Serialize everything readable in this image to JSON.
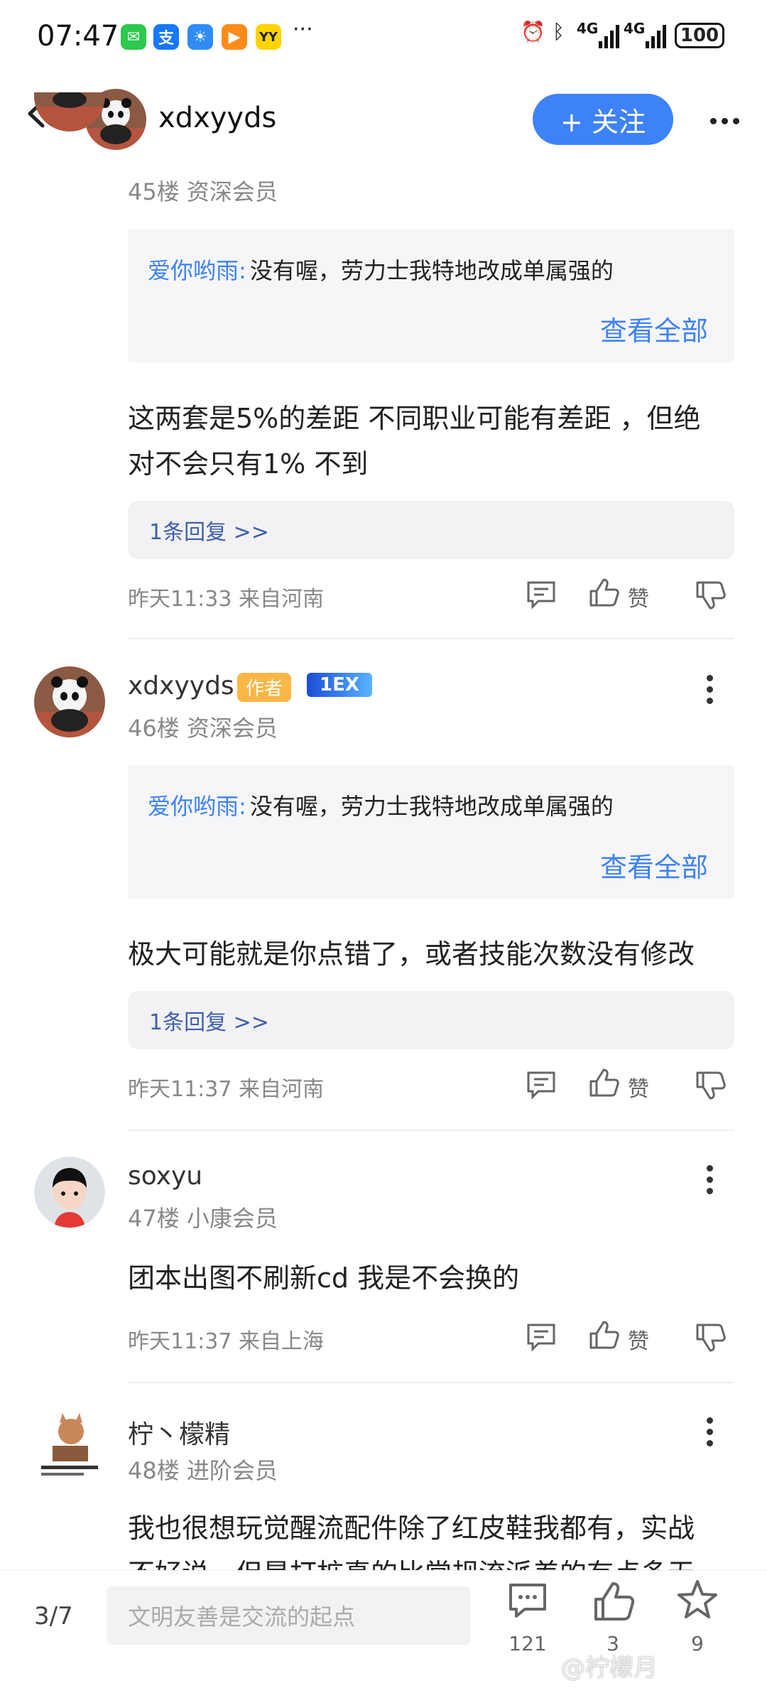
{
  "status": {
    "time": "07:47",
    "app_icons": [
      "wechat-icon",
      "alipay-icon",
      "weather-icon",
      "video-app-icon",
      "yy-icon"
    ],
    "more": "···",
    "network1": "4G",
    "network2": "4G",
    "battery": "100"
  },
  "header": {
    "username": "xdxyyds",
    "follow_label": "+ 关注"
  },
  "comments": [
    {
      "floor": "45楼 资深会员",
      "quote_user": "爱你哟雨:",
      "quote_text": "没有喔，劳力士我特地改成单属强的",
      "quote_more": "查看全部",
      "body_line1": "这两套是5%的差距 不同职业可能有差距 ，但绝",
      "body_line2": "对不会只有1% 不到",
      "replies": "1条回复 >>",
      "meta": "昨天11:33 来自河南",
      "like_label": "赞"
    },
    {
      "username": "xdxyyds",
      "author_tag": "作者",
      "badge": "1EX",
      "floor": "46楼 资深会员",
      "quote_user": "爱你哟雨:",
      "quote_text": "没有喔，劳力士我特地改成单属强的",
      "quote_more": "查看全部",
      "body": "极大可能就是你点错了，或者技能次数没有修改",
      "replies": "1条回复 >>",
      "meta": "昨天11:37 来自河南",
      "like_label": "赞"
    },
    {
      "username": "soxyu",
      "floor": "47楼 小康会员",
      "body": "团本出图不刷新cd 我是不会换的",
      "meta": "昨天11:37 来自上海",
      "like_label": "赞"
    },
    {
      "username": "柠丶檬精",
      "floor": "48楼 进阶会员",
      "body_line1": "我也很想玩觉醒流配件除了红皮鞋我都有，实战",
      "body_line2": "不好说，但是打桩真的比常规流派差的有点多无"
    }
  ],
  "bottom": {
    "page": "3/7",
    "input_placeholder": "文明友善是交流的起点",
    "comment_count": "121",
    "like_count": "3",
    "fav_count": "9",
    "watermark": "@柠檬月"
  }
}
